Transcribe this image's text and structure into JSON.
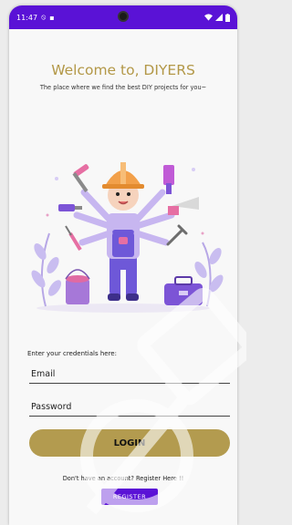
{
  "status_bar": {
    "time": "11:47",
    "left_icons": [
      "do-not-disturb-icon",
      "sim-card-icon"
    ],
    "right_icons": [
      "wifi-icon",
      "signal-icon",
      "battery-icon"
    ]
  },
  "header": {
    "title": "Welcome to, DIYERS",
    "subtitle": "The place where we find the best DIY projects for you~"
  },
  "form": {
    "credentials_label": "Enter your credentials here:",
    "email_placeholder": "Email",
    "password_placeholder": "Password",
    "login_label": "LOGIN"
  },
  "footer": {
    "signup_text": "Don't have an account? Register Here !!",
    "register_label": "REGISTER"
  },
  "colors": {
    "accent": "#5a12d6",
    "gold": "#b39b4f",
    "title_gold": "#b39848"
  }
}
